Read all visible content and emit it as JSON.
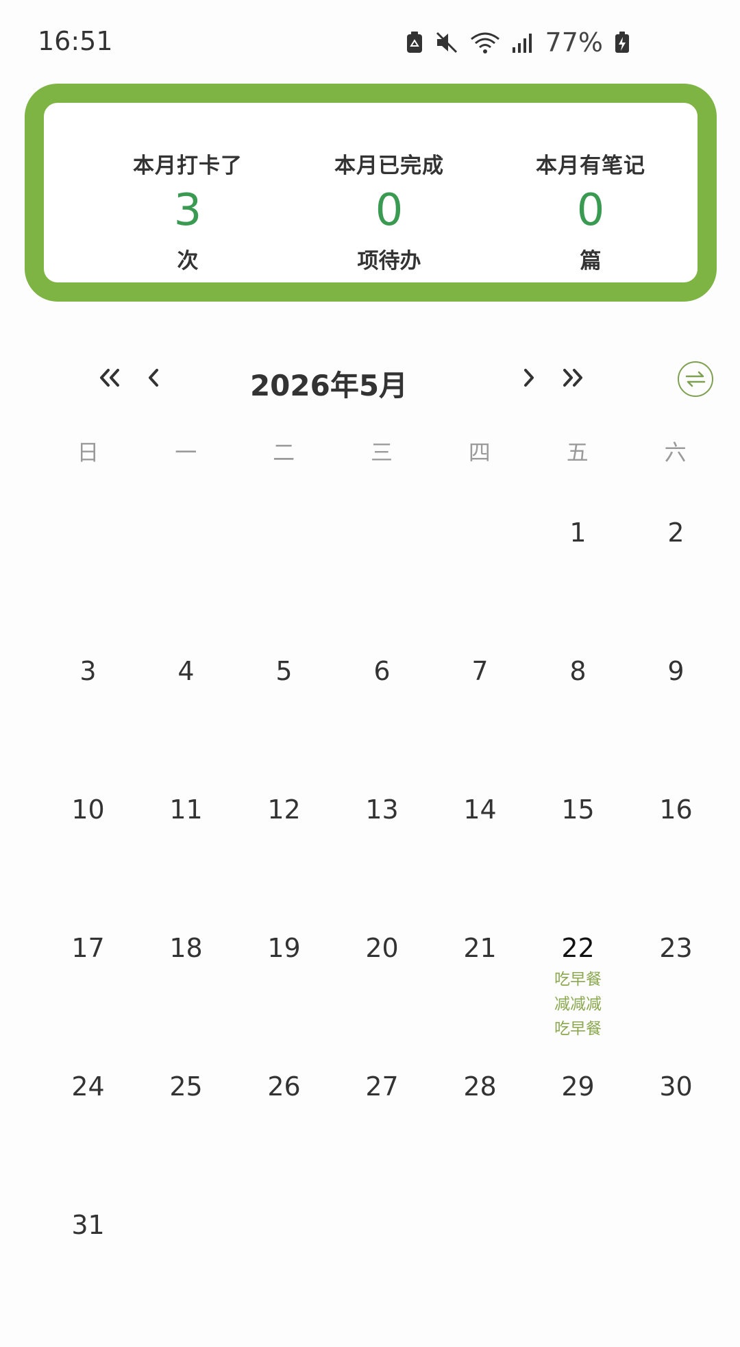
{
  "status_bar": {
    "time": "16:51",
    "battery": "77%",
    "icons": [
      "battery-saver-icon",
      "mute-icon",
      "wifi-icon",
      "signal-icon",
      "battery-charging-icon"
    ]
  },
  "summary": {
    "checkins": {
      "title": "本月打卡了",
      "value": "3",
      "unit": "次"
    },
    "completed": {
      "title": "本月已完成",
      "value": "0",
      "unit": "项待办"
    },
    "notes": {
      "title": "本月有笔记",
      "value": "0",
      "unit": "篇"
    }
  },
  "calendar": {
    "month_title": "2026年5月",
    "weekdays": [
      "日",
      "一",
      "二",
      "三",
      "四",
      "五",
      "六"
    ],
    "weeks": [
      [
        "",
        "",
        "",
        "",
        "",
        "1",
        "2"
      ],
      [
        "3",
        "4",
        "5",
        "6",
        "7",
        "8",
        "9"
      ],
      [
        "10",
        "11",
        "12",
        "13",
        "14",
        "15",
        "16"
      ],
      [
        "17",
        "18",
        "19",
        "20",
        "21",
        "22",
        "23"
      ],
      [
        "24",
        "25",
        "26",
        "27",
        "28",
        "29",
        "30"
      ],
      [
        "31",
        "",
        "",
        "",
        "",
        "",
        ""
      ]
    ],
    "today": "22",
    "day_notes": {
      "22": [
        "吃早餐",
        "减减减",
        "吃早餐"
      ]
    }
  },
  "colors": {
    "accent_green": "#7db443",
    "value_green": "#3a9a52",
    "note_green": "#8aa84f"
  }
}
